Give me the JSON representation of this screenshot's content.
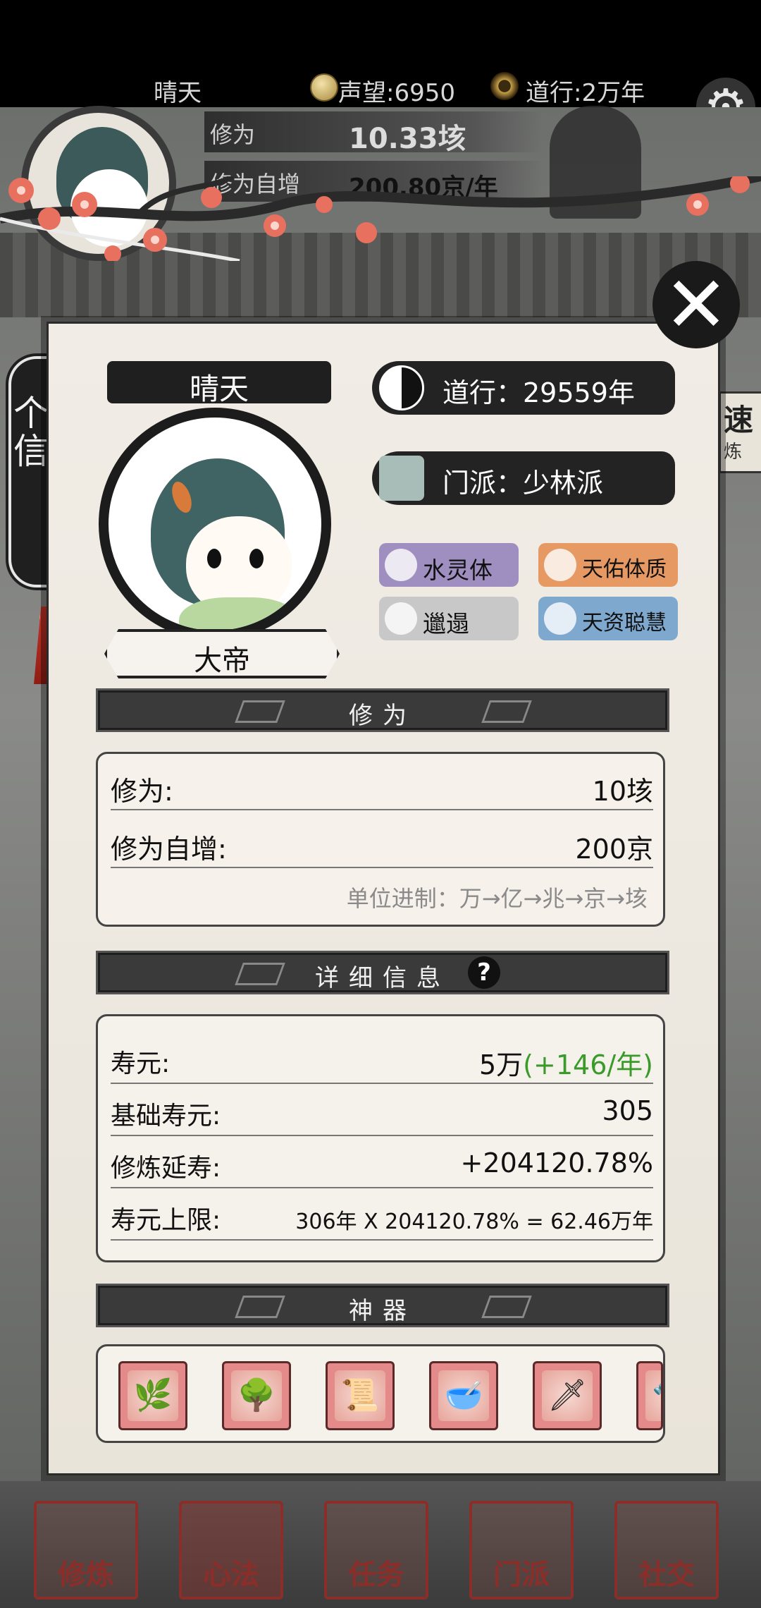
{
  "top": {
    "player_name": "晴天",
    "reputation": "声望:6950",
    "dao": "道行:2万年",
    "colors": {
      "bar_bg": "#000000",
      "text": "#d8d8d8"
    }
  },
  "hud": {
    "cultivation_label": "修为",
    "cultivation_value": "10.33垓",
    "rate_label": "修为自增",
    "rate_value": "200.80京/年"
  },
  "side_tab": {
    "label": "个人信息"
  },
  "right_tab": {
    "title": "速",
    "sub": "炼"
  },
  "profile": {
    "name": "晴天",
    "rank": "大帝",
    "dao_text": "道行：29559年",
    "sect_text": "门派：少林派",
    "traits": [
      "水灵体",
      "天佑体质",
      "邋遢",
      "天资聪慧"
    ],
    "trait_colors": [
      "#9f8fc0",
      "#e69963",
      "#c8c8c8",
      "#7fa8cf"
    ]
  },
  "cultivation": {
    "header": "修为",
    "rows": [
      {
        "label": "修为:",
        "value": "10垓"
      },
      {
        "label": "修为自增:",
        "value": "200京"
      }
    ],
    "unit_note": "单位进制：万→亿→兆→京→垓"
  },
  "details": {
    "header": "详细信息",
    "help": "?",
    "lifespan_label": "寿元:",
    "lifespan_value": "5万",
    "lifespan_gain": "(+146/年)",
    "base_label": "基础寿元:",
    "base_value": "305",
    "ext_label": "修炼延寿:",
    "ext_value": "+204120.78%",
    "limit_label": "寿元上限:",
    "limit_value": "306年 X 204120.78% = 62.46万年",
    "colors": {
      "gain": "#3a9a2a"
    }
  },
  "artifacts": {
    "header": "神器",
    "items": [
      "vase-icon",
      "bonsai-icon",
      "scroll-icon",
      "bowl-icon",
      "sword-icon",
      "partial-icon"
    ]
  },
  "nav": {
    "items": [
      "修炼",
      "心法",
      "任务",
      "门派",
      "社交"
    ],
    "active": "心法"
  }
}
